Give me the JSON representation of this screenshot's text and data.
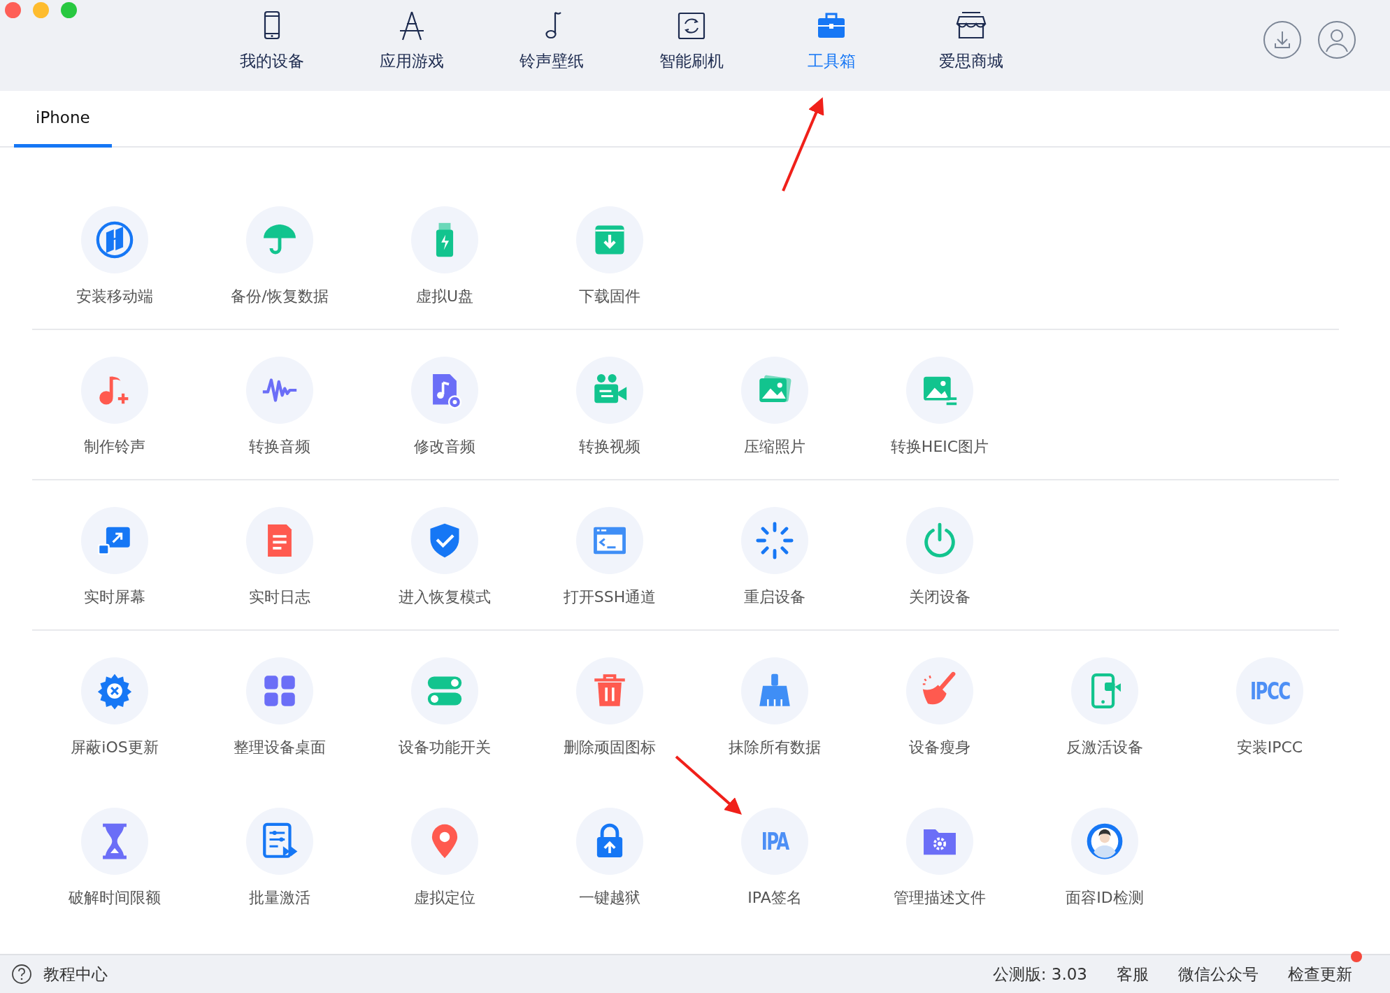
{
  "nav": [
    {
      "label": "我的设备",
      "selected": false
    },
    {
      "label": "应用游戏",
      "selected": false
    },
    {
      "label": "铃声壁纸",
      "selected": false
    },
    {
      "label": "智能刷机",
      "selected": false
    },
    {
      "label": "工具箱",
      "selected": true
    },
    {
      "label": "爱思商城",
      "selected": false
    }
  ],
  "tabs": [
    {
      "label": "iPhone",
      "selected": true
    }
  ],
  "sections": [
    {
      "tools": [
        {
          "label": "安装移动端"
        },
        {
          "label": "备份/恢复数据"
        },
        {
          "label": "虚拟U盘"
        },
        {
          "label": "下载固件"
        }
      ]
    },
    {
      "tools": [
        {
          "label": "制作铃声"
        },
        {
          "label": "转换音频"
        },
        {
          "label": "修改音频"
        },
        {
          "label": "转换视频"
        },
        {
          "label": "压缩照片"
        },
        {
          "label": "转换HEIC图片"
        }
      ]
    },
    {
      "tools": [
        {
          "label": "实时屏幕"
        },
        {
          "label": "实时日志"
        },
        {
          "label": "进入恢复模式"
        },
        {
          "label": "打开SSH通道"
        },
        {
          "label": "重启设备"
        },
        {
          "label": "关闭设备"
        }
      ]
    },
    {
      "tools": [
        {
          "label": "屏蔽iOS更新"
        },
        {
          "label": "整理设备桌面"
        },
        {
          "label": "设备功能开关"
        },
        {
          "label": "删除顽固图标"
        },
        {
          "label": "抹除所有数据"
        },
        {
          "label": "设备瘦身"
        },
        {
          "label": "反激活设备"
        },
        {
          "label": "安装IPCC",
          "icon_text": "IPCC"
        },
        {
          "label": "破解时间限额"
        },
        {
          "label": "批量激活"
        },
        {
          "label": "虚拟定位"
        },
        {
          "label": "一键越狱"
        },
        {
          "label": "IPA签名",
          "icon_text": "IPA"
        },
        {
          "label": "管理描述文件"
        },
        {
          "label": "面容ID检测"
        }
      ]
    }
  ],
  "status_bar": {
    "help": "教程中心",
    "version": "公测版: 3.03",
    "links": [
      "客服",
      "微信公众号"
    ],
    "update": {
      "label": "检查更新",
      "has_notification": true
    }
  }
}
